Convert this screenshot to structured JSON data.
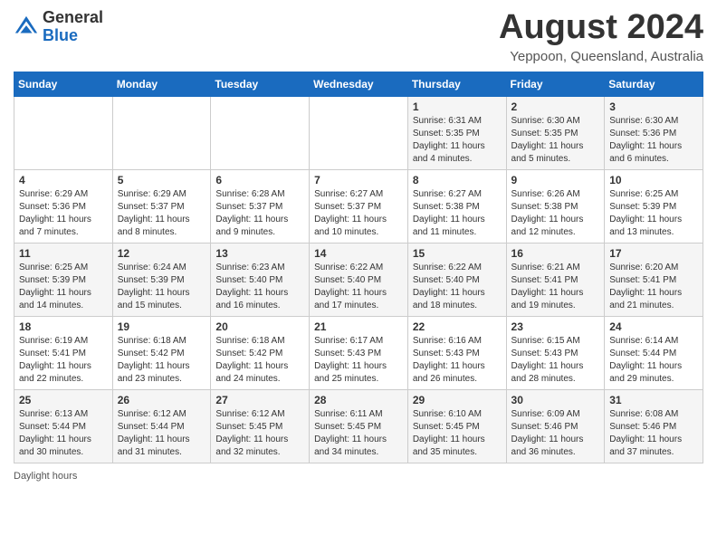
{
  "header": {
    "logo_general": "General",
    "logo_blue": "Blue",
    "month_title": "August 2024",
    "subtitle": "Yeppoon, Queensland, Australia"
  },
  "calendar": {
    "days_of_week": [
      "Sunday",
      "Monday",
      "Tuesday",
      "Wednesday",
      "Thursday",
      "Friday",
      "Saturday"
    ],
    "weeks": [
      [
        {
          "day": "",
          "info": ""
        },
        {
          "day": "",
          "info": ""
        },
        {
          "day": "",
          "info": ""
        },
        {
          "day": "",
          "info": ""
        },
        {
          "day": "1",
          "info": "Sunrise: 6:31 AM\nSunset: 5:35 PM\nDaylight: 11 hours and 4 minutes."
        },
        {
          "day": "2",
          "info": "Sunrise: 6:30 AM\nSunset: 5:35 PM\nDaylight: 11 hours and 5 minutes."
        },
        {
          "day": "3",
          "info": "Sunrise: 6:30 AM\nSunset: 5:36 PM\nDaylight: 11 hours and 6 minutes."
        }
      ],
      [
        {
          "day": "4",
          "info": "Sunrise: 6:29 AM\nSunset: 5:36 PM\nDaylight: 11 hours and 7 minutes."
        },
        {
          "day": "5",
          "info": "Sunrise: 6:29 AM\nSunset: 5:37 PM\nDaylight: 11 hours and 8 minutes."
        },
        {
          "day": "6",
          "info": "Sunrise: 6:28 AM\nSunset: 5:37 PM\nDaylight: 11 hours and 9 minutes."
        },
        {
          "day": "7",
          "info": "Sunrise: 6:27 AM\nSunset: 5:37 PM\nDaylight: 11 hours and 10 minutes."
        },
        {
          "day": "8",
          "info": "Sunrise: 6:27 AM\nSunset: 5:38 PM\nDaylight: 11 hours and 11 minutes."
        },
        {
          "day": "9",
          "info": "Sunrise: 6:26 AM\nSunset: 5:38 PM\nDaylight: 11 hours and 12 minutes."
        },
        {
          "day": "10",
          "info": "Sunrise: 6:25 AM\nSunset: 5:39 PM\nDaylight: 11 hours and 13 minutes."
        }
      ],
      [
        {
          "day": "11",
          "info": "Sunrise: 6:25 AM\nSunset: 5:39 PM\nDaylight: 11 hours and 14 minutes."
        },
        {
          "day": "12",
          "info": "Sunrise: 6:24 AM\nSunset: 5:39 PM\nDaylight: 11 hours and 15 minutes."
        },
        {
          "day": "13",
          "info": "Sunrise: 6:23 AM\nSunset: 5:40 PM\nDaylight: 11 hours and 16 minutes."
        },
        {
          "day": "14",
          "info": "Sunrise: 6:22 AM\nSunset: 5:40 PM\nDaylight: 11 hours and 17 minutes."
        },
        {
          "day": "15",
          "info": "Sunrise: 6:22 AM\nSunset: 5:40 PM\nDaylight: 11 hours and 18 minutes."
        },
        {
          "day": "16",
          "info": "Sunrise: 6:21 AM\nSunset: 5:41 PM\nDaylight: 11 hours and 19 minutes."
        },
        {
          "day": "17",
          "info": "Sunrise: 6:20 AM\nSunset: 5:41 PM\nDaylight: 11 hours and 21 minutes."
        }
      ],
      [
        {
          "day": "18",
          "info": "Sunrise: 6:19 AM\nSunset: 5:41 PM\nDaylight: 11 hours and 22 minutes."
        },
        {
          "day": "19",
          "info": "Sunrise: 6:18 AM\nSunset: 5:42 PM\nDaylight: 11 hours and 23 minutes."
        },
        {
          "day": "20",
          "info": "Sunrise: 6:18 AM\nSunset: 5:42 PM\nDaylight: 11 hours and 24 minutes."
        },
        {
          "day": "21",
          "info": "Sunrise: 6:17 AM\nSunset: 5:43 PM\nDaylight: 11 hours and 25 minutes."
        },
        {
          "day": "22",
          "info": "Sunrise: 6:16 AM\nSunset: 5:43 PM\nDaylight: 11 hours and 26 minutes."
        },
        {
          "day": "23",
          "info": "Sunrise: 6:15 AM\nSunset: 5:43 PM\nDaylight: 11 hours and 28 minutes."
        },
        {
          "day": "24",
          "info": "Sunrise: 6:14 AM\nSunset: 5:44 PM\nDaylight: 11 hours and 29 minutes."
        }
      ],
      [
        {
          "day": "25",
          "info": "Sunrise: 6:13 AM\nSunset: 5:44 PM\nDaylight: 11 hours and 30 minutes."
        },
        {
          "day": "26",
          "info": "Sunrise: 6:12 AM\nSunset: 5:44 PM\nDaylight: 11 hours and 31 minutes."
        },
        {
          "day": "27",
          "info": "Sunrise: 6:12 AM\nSunset: 5:45 PM\nDaylight: 11 hours and 32 minutes."
        },
        {
          "day": "28",
          "info": "Sunrise: 6:11 AM\nSunset: 5:45 PM\nDaylight: 11 hours and 34 minutes."
        },
        {
          "day": "29",
          "info": "Sunrise: 6:10 AM\nSunset: 5:45 PM\nDaylight: 11 hours and 35 minutes."
        },
        {
          "day": "30",
          "info": "Sunrise: 6:09 AM\nSunset: 5:46 PM\nDaylight: 11 hours and 36 minutes."
        },
        {
          "day": "31",
          "info": "Sunrise: 6:08 AM\nSunset: 5:46 PM\nDaylight: 11 hours and 37 minutes."
        }
      ]
    ]
  },
  "legend": {
    "daylight_hours": "Daylight hours"
  }
}
